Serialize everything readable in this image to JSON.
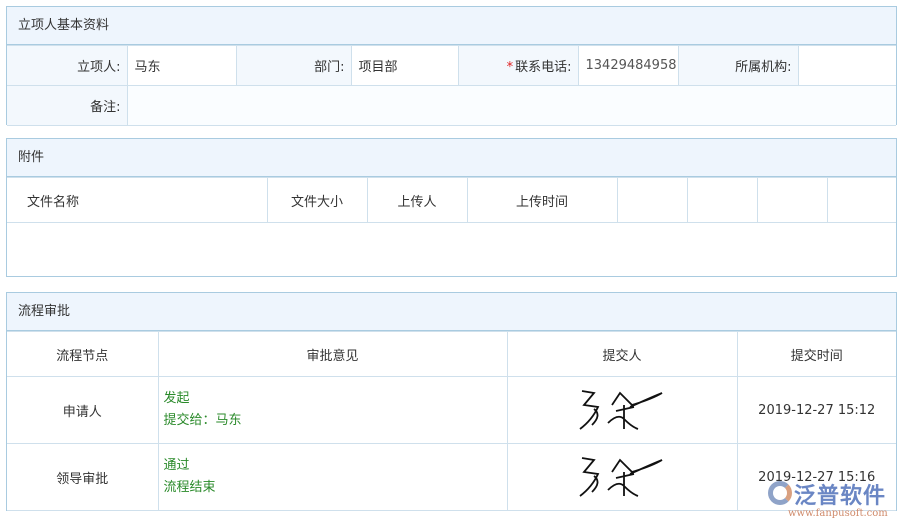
{
  "basic": {
    "title": "立项人基本资料",
    "applicant_label": "立项人:",
    "applicant": "马东",
    "dept_label": "部门:",
    "dept": "项目部",
    "phone_required": "*",
    "phone_label": "联系电话:",
    "phone": "13429484958",
    "org_label": "所属机构:",
    "org": "",
    "remark_label": "备注:",
    "remark": ""
  },
  "attach": {
    "title": "附件",
    "columns": [
      "文件名称",
      "文件大小",
      "上传人",
      "上传时间",
      "",
      "",
      "",
      ""
    ]
  },
  "flow": {
    "title": "流程审批",
    "columns": [
      "流程节点",
      "审批意见",
      "提交人",
      "提交时间"
    ],
    "rows": [
      {
        "node": "申请人",
        "opinion1": "发起",
        "opinion2": "提交给：马东",
        "signer": "马东",
        "time": "2019-12-27 15:12"
      },
      {
        "node": "领导审批",
        "opinion1": "通过",
        "opinion2": "流程结束",
        "signer": "马东",
        "time": "2019-12-27 15:16"
      }
    ]
  },
  "watermark": {
    "brand": "泛普软件",
    "url": "www.fanpusoft.com"
  }
}
